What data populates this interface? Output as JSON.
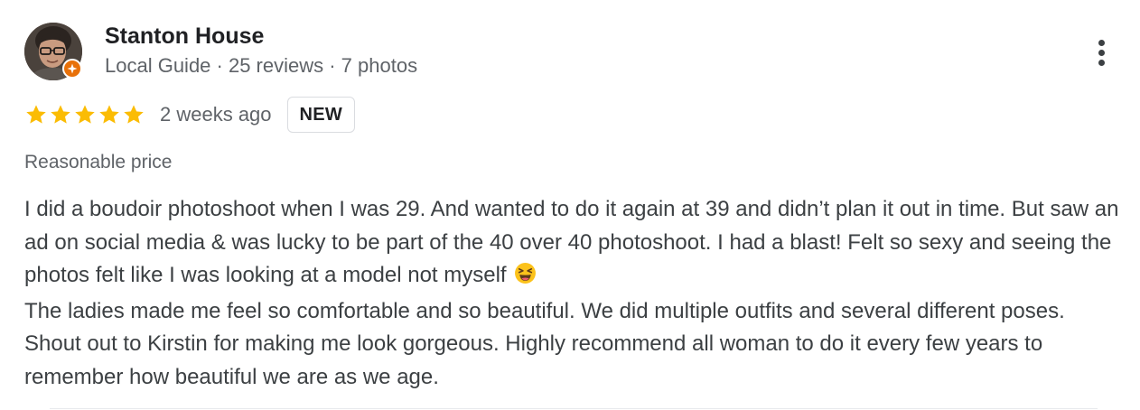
{
  "reviewer": {
    "name": "Stanton House",
    "meta": "Local Guide · 25 reviews · 7 photos",
    "avatar_icon": "user-avatar-photo",
    "badge_icon": "local-guide-badge-icon"
  },
  "actions": {
    "more_icon": "more-vert-icon"
  },
  "rating": {
    "stars": 5,
    "max_stars": 5,
    "star_color": "#fbbc04",
    "time": "2 weeks ago",
    "badge": "NEW"
  },
  "attribute": "Reasonable price",
  "review_text": {
    "paragraph1": "I did a boudoir photoshoot when I was 29. And wanted to do it again at 39 and didn’t plan it out in time. But saw an ad on social media & was lucky to be part of the 40 over 40 photoshoot. I had a blast! Felt so sexy and seeing the photos felt like I was looking at a model not myself",
    "emoji_icon": "laughing-squint-emoji-icon",
    "paragraph2": "The ladies made me feel so comfortable and so beautiful. We did multiple outfits and several different poses. Shout out to Kirstin for making me look gorgeous. Highly recommend all woman to do it every few years to remember how beautiful we are as we age."
  },
  "colors": {
    "name": "#202124",
    "secondary": "#5f6368",
    "body": "#3c4043",
    "badge_orange": "#e8710a",
    "star": "#fbbc04"
  }
}
